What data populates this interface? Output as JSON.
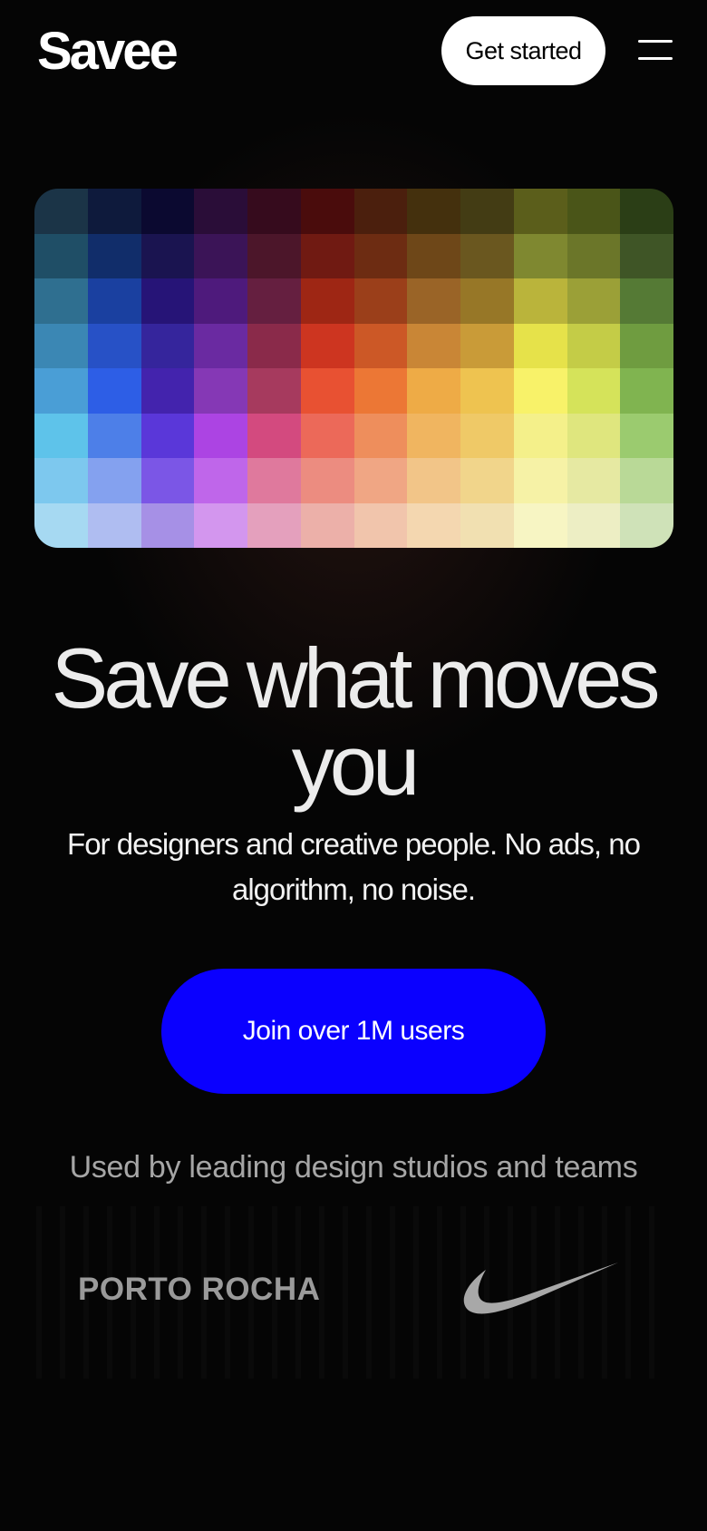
{
  "header": {
    "logo": "Savee",
    "cta_label": "Get started",
    "menu_icon": "hamburger-menu-icon"
  },
  "hero": {
    "palette": {
      "rows": [
        [
          "#1b3447",
          "#0e1a3c",
          "#0b0930",
          "#2a0d38",
          "#360b1d",
          "#4a0c0c",
          "#4b1f0d",
          "#44300d",
          "#433c14",
          "#5b5e1b",
          "#4a5518",
          "#2b3e16"
        ],
        [
          "#1f4e66",
          "#112d6a",
          "#1a1450",
          "#3b1457",
          "#4c162a",
          "#701a12",
          "#6d2c12",
          "#6e4718",
          "#6a571f",
          "#7f8830",
          "#6b7629",
          "#3f5526"
        ],
        [
          "#2f6f90",
          "#1a40a0",
          "#261477",
          "#4e1a7c",
          "#651f40",
          "#9e2614",
          "#9b3f1a",
          "#9a6427",
          "#977727",
          "#bab43b",
          "#9ba037",
          "#557a35"
        ],
        [
          "#3b87b4",
          "#2751c6",
          "#35259c",
          "#6a2aa1",
          "#8a2a4a",
          "#cd3520",
          "#cc5826",
          "#c98636",
          "#c99b38",
          "#e6e24a",
          "#c4cc47",
          "#6f9c40"
        ],
        [
          "#4a9ed6",
          "#2d5ee6",
          "#4323ad",
          "#8538b5",
          "#a63a5e",
          "#e85132",
          "#ec7735",
          "#eeab46",
          "#eec350",
          "#f8f269",
          "#d5e35a",
          "#80b450"
        ],
        [
          "#5ec3ea",
          "#4d7fe8",
          "#5a37d9",
          "#ac44e3",
          "#d34a7f",
          "#ec6959",
          "#ee8e5c",
          "#f0b560",
          "#efc967",
          "#f4f08a",
          "#dfe67e",
          "#9bcb6f"
        ],
        [
          "#7dc8ee",
          "#84a1ef",
          "#7b56e6",
          "#bf66ea",
          "#df799d",
          "#ec8c80",
          "#f0a684",
          "#f2c588",
          "#f1d58b",
          "#f6f2a6",
          "#e6e9a2",
          "#b9d997"
        ],
        [
          "#a6d9f2",
          "#afbdf1",
          "#a690e6",
          "#d396ee",
          "#e4a0bd",
          "#ecb0a9",
          "#f1c5ac",
          "#f4d7b0",
          "#f1e0b1",
          "#f7f5c3",
          "#edeec4",
          "#cfe2b8"
        ]
      ]
    },
    "headline": "Save what moves you",
    "subheadline": "For designers and creative people. No ads, no algorithm, no noise.",
    "cta_label": "Join over 1M users",
    "cta_color": "#0a00ff"
  },
  "social_proof": {
    "caption": "Used by leading design studios and teams",
    "logos": [
      "PORTO ROCHA",
      "nike-swoosh-logo"
    ]
  }
}
